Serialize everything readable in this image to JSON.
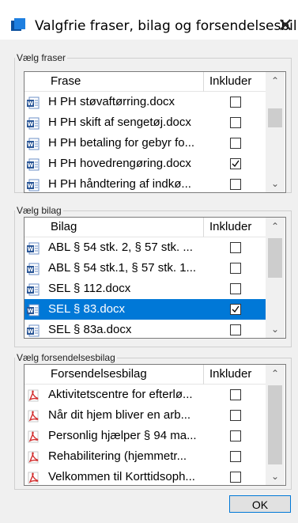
{
  "window": {
    "title": "Valgfrie fraser, bilag og forsendelsesbil...",
    "close": "✕"
  },
  "phrases": {
    "legend": "Vælg fraser",
    "col_name": "Frase",
    "col_include": "Inkluder",
    "rows": [
      {
        "name": "H PH støvaftørring.docx",
        "checked": false,
        "icon": "word-icon"
      },
      {
        "name": "H PH skift af sengetøj.docx",
        "checked": false,
        "icon": "word-icon"
      },
      {
        "name": "H PH betaling for gebyr fo...",
        "checked": false,
        "icon": "word-icon"
      },
      {
        "name": "H PH hovedrengøring.docx",
        "checked": true,
        "icon": "word-icon"
      },
      {
        "name": "H PH håndtering af indkø...",
        "checked": false,
        "icon": "word-icon"
      }
    ]
  },
  "attachments": {
    "legend": "Vælg bilag",
    "col_name": "Bilag",
    "col_include": "Inkluder",
    "rows": [
      {
        "name": "ABL § 54  stk. 2, § 57 stk. ...",
        "checked": false,
        "icon": "word-icon"
      },
      {
        "name": "ABL § 54 stk.1, § 57 stk. 1...",
        "checked": false,
        "icon": "word-icon"
      },
      {
        "name": "SEL § 112.docx",
        "checked": false,
        "icon": "word-icon"
      },
      {
        "name": "SEL § 83.docx",
        "checked": true,
        "icon": "word-icon",
        "selected": true
      },
      {
        "name": "SEL § 83a.docx",
        "checked": false,
        "icon": "word-icon"
      }
    ]
  },
  "shipping": {
    "legend": "Vælg forsendelsesbilag",
    "col_name": "Forsendelsesbilag",
    "col_include": "Inkluder",
    "rows": [
      {
        "name": "Aktivitetscentre for efterlø...",
        "checked": false,
        "icon": "pdf-icon"
      },
      {
        "name": "Når dit hjem bliver en arb...",
        "checked": false,
        "icon": "pdf-icon"
      },
      {
        "name": "Personlig hjælper § 94 ma...",
        "checked": false,
        "icon": "pdf-icon"
      },
      {
        "name": "Rehabilitering (hjemmetr...",
        "checked": false,
        "icon": "pdf-icon"
      },
      {
        "name": "Velkommen til Korttidsoph...",
        "checked": false,
        "icon": "pdf-icon"
      }
    ]
  },
  "footer": {
    "ok_label": "OK"
  },
  "colors": {
    "selection": "#0078d7",
    "app_icon": "#0067c0"
  }
}
